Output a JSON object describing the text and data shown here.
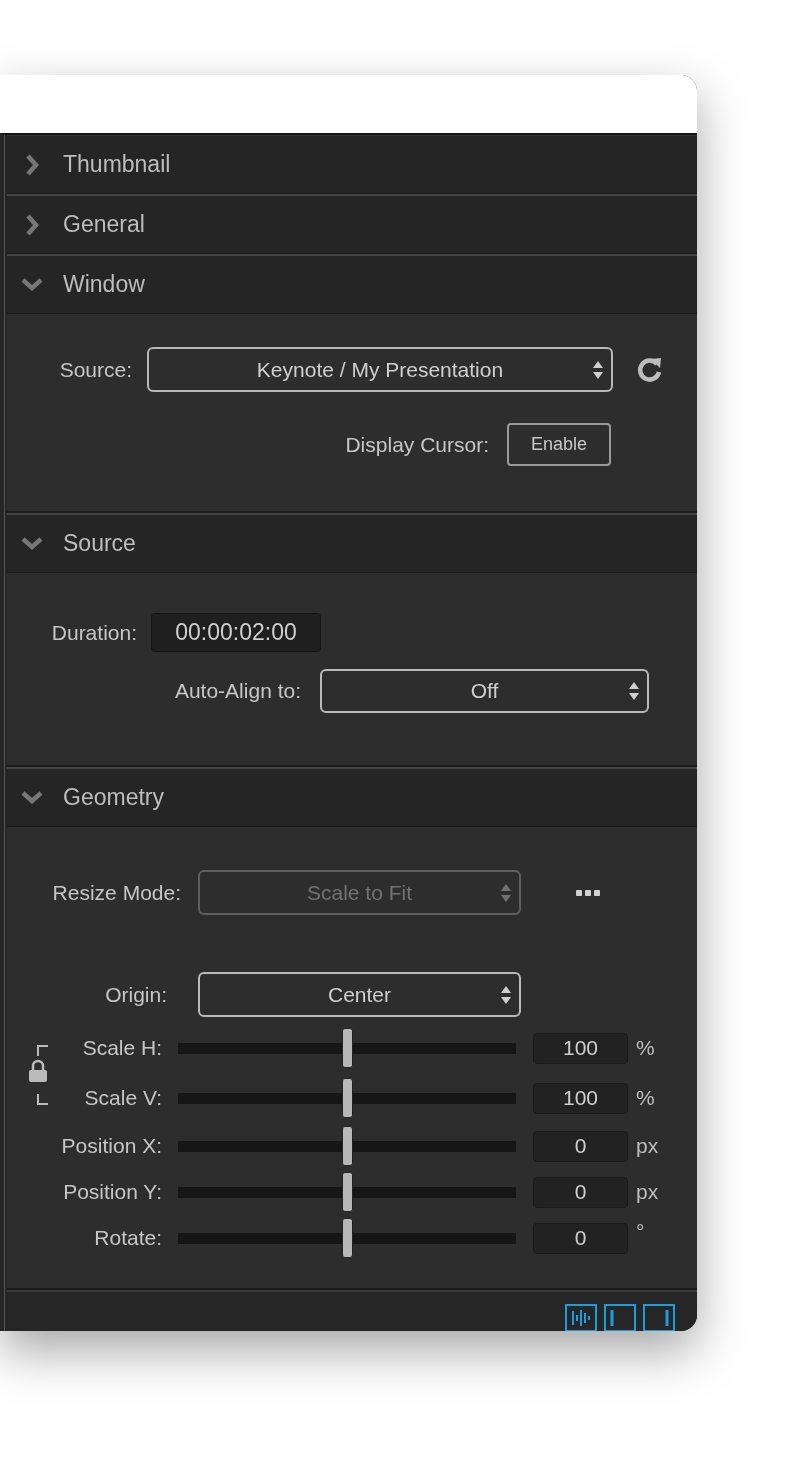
{
  "sections": [
    {
      "title": "Thumbnail",
      "expanded": false
    },
    {
      "title": "General",
      "expanded": false
    },
    {
      "title": "Window",
      "expanded": true,
      "rows": [
        {
          "kind": "select",
          "label": "Source:",
          "value": "Keynote / My Presentation",
          "disabled": false,
          "refresh_button": true
        },
        {
          "kind": "button",
          "label": "Display Cursor:",
          "value": "Enable"
        }
      ]
    },
    {
      "title": "Source",
      "expanded": true,
      "rows": [
        {
          "kind": "timecode",
          "label": "Duration:",
          "value": "00:00:02:00"
        },
        {
          "kind": "select",
          "label": "Auto-Align to:",
          "value": "Off",
          "disabled": false
        }
      ]
    },
    {
      "title": "Geometry",
      "expanded": true,
      "rows": [
        {
          "kind": "select",
          "label": "Resize Mode:",
          "value": "Scale to Fit",
          "disabled": true,
          "more_button": true
        },
        {
          "kind": "select",
          "label": "Origin:",
          "value": "Center",
          "disabled": false
        },
        {
          "kind": "slider",
          "label": "Scale H:",
          "level": 0.5,
          "value": "100",
          "unit": "%",
          "locked_with_next": true
        },
        {
          "kind": "slider",
          "label": "Scale V:",
          "level": 0.5,
          "value": "100",
          "unit": "%"
        },
        {
          "kind": "slider",
          "label": "Position X:",
          "level": 0.5,
          "value": "0",
          "unit": "px"
        },
        {
          "kind": "slider",
          "label": "Position Y:",
          "level": 0.5,
          "value": "0",
          "unit": "px"
        },
        {
          "kind": "slider",
          "label": "Rotate:",
          "level": 0.5,
          "value": "0",
          "unit": "°"
        }
      ]
    }
  ]
}
